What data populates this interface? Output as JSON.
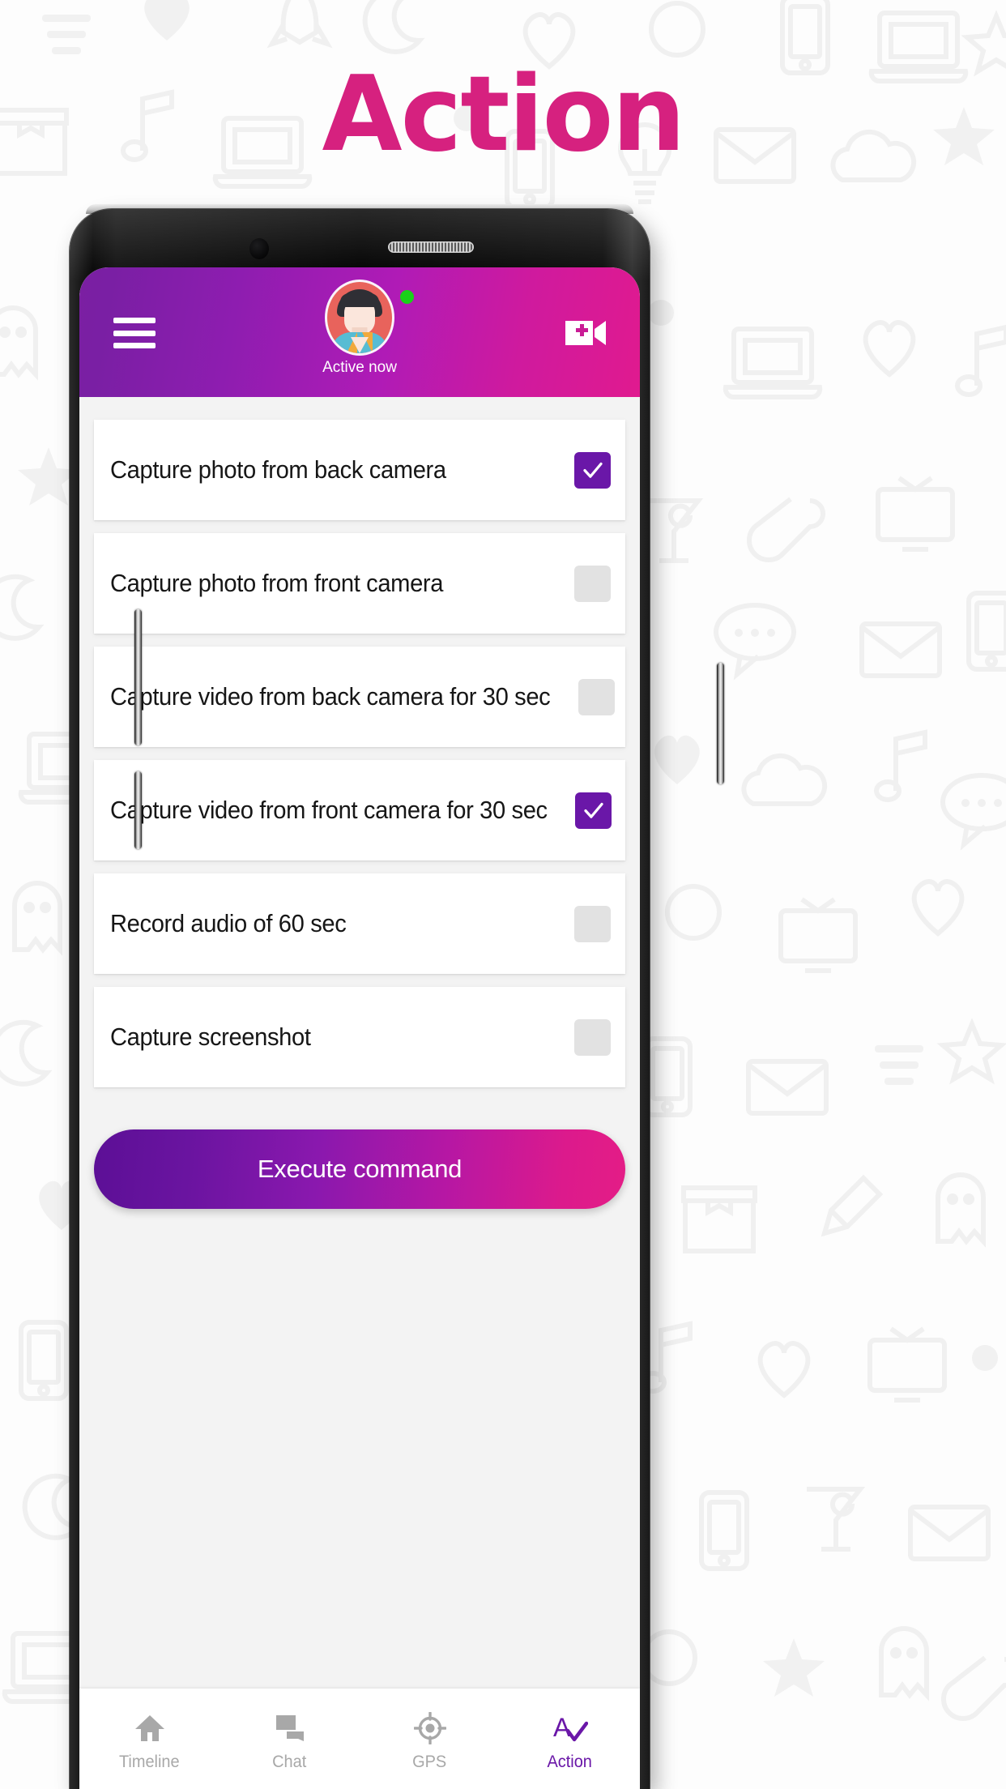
{
  "page": {
    "title": "Action",
    "title_color": "#d6217f"
  },
  "appbar": {
    "menu_icon": "hamburger-menu-icon",
    "avatar_icon": "user-avatar-icon",
    "status_text": "Active now",
    "online_indicator_color": "#19d219",
    "video_call_icon": "video-call-add-icon",
    "gradient_from": "#7b1fa2",
    "gradient_to": "#e01a8f"
  },
  "actions": [
    {
      "label": "Capture photo from back camera",
      "checked": true
    },
    {
      "label": "Capture photo from front camera",
      "checked": false
    },
    {
      "label": "Capture video from back camera for 30 sec",
      "checked": false
    },
    {
      "label": "Capture video from front camera for 30 sec",
      "checked": true
    },
    {
      "label": "Record audio of 60 sec",
      "checked": false
    },
    {
      "label": "Capture screenshot",
      "checked": false
    }
  ],
  "checkbox": {
    "checked_color": "#6a17a8",
    "unchecked_color": "#e2e2e2"
  },
  "execute_button": {
    "label": "Execute command",
    "gradient_from": "#5c0f96",
    "gradient_to": "#e41d86"
  },
  "bottom_nav": {
    "items": [
      {
        "label": "Timeline",
        "icon": "home-icon",
        "active": false
      },
      {
        "label": "Chat",
        "icon": "chat-bubbles-icon",
        "active": false
      },
      {
        "label": "GPS",
        "icon": "location-crosshair-icon",
        "active": false
      },
      {
        "label": "Action",
        "icon": "action-check-icon",
        "active": true
      }
    ],
    "active_color": "#6a17a8",
    "inactive_color": "#a8a8a8"
  }
}
